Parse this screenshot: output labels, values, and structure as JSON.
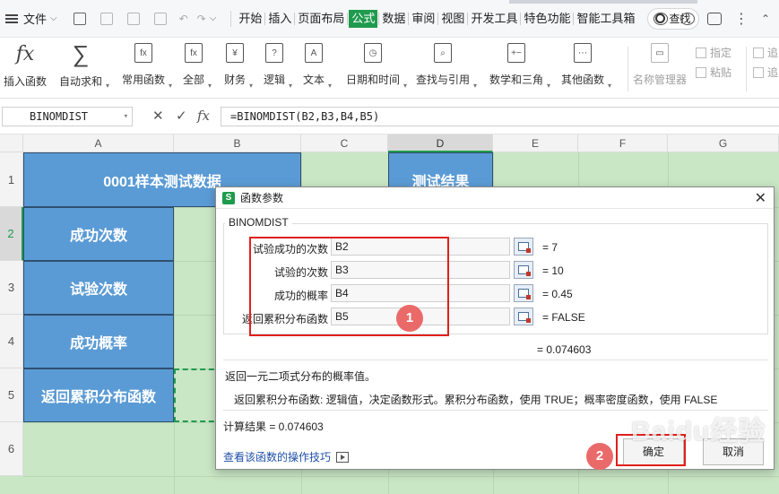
{
  "menubar": {
    "file_label": "文件",
    "tabs": [
      "开始",
      "插入",
      "页面布局",
      "公式",
      "数据",
      "审阅",
      "视图",
      "开发工具",
      "特色功能",
      "智能工具箱"
    ],
    "active_tab": "公式",
    "search_label": "查找"
  },
  "ribbon": {
    "items": [
      {
        "label": "插入函数",
        "icon": "fx-icon"
      },
      {
        "label": "自动求和",
        "icon": "sum-icon"
      },
      {
        "label": "常用函数",
        "icon": "star-function-icon"
      },
      {
        "label": "全部",
        "icon": "all-function-icon"
      },
      {
        "label": "财务",
        "icon": "finance-icon"
      },
      {
        "label": "逻辑",
        "icon": "logic-icon"
      },
      {
        "label": "文本",
        "icon": "text-icon"
      },
      {
        "label": "日期和时间",
        "icon": "clock-icon"
      },
      {
        "label": "查找与引用",
        "icon": "lookup-icon"
      },
      {
        "label": "数学和三角",
        "icon": "math-icon"
      },
      {
        "label": "其他函数",
        "icon": "more-function-icon"
      },
      {
        "label": "名称管理器",
        "icon": "name-manager-icon"
      }
    ],
    "side_items": [
      "指定",
      "粘贴"
    ],
    "far_right_items": [
      "追",
      "追"
    ]
  },
  "formula_bar": {
    "name_box": "BINOMDIST",
    "formula": "=BINOMDIST(B2,B3,B4,B5)"
  },
  "sheet": {
    "columns": [
      "A",
      "B",
      "C",
      "D",
      "E",
      "F",
      "G"
    ],
    "rows": [
      "1",
      "2",
      "3",
      "4",
      "5",
      "6"
    ],
    "a1": "0001样本测试数据",
    "d1": "测试结果",
    "a2": "成功次数",
    "a3": "试验次数",
    "a4": "成功概率",
    "a5": "返回累积分布函数"
  },
  "dialog": {
    "title": "函数参数",
    "function_name": "BINOMDIST",
    "args": [
      {
        "label": "试验成功的次数",
        "input": "B2",
        "value": "= 7"
      },
      {
        "label": "试验的次数",
        "input": "B3",
        "value": "= 10"
      },
      {
        "label": "成功的概率",
        "input": "B4",
        "value": "= 0.45"
      },
      {
        "label": "返回累积分布函数",
        "input": "B5",
        "value": "= FALSE"
      }
    ],
    "result_value": "= 0.074603",
    "description": "返回一元二项式分布的概率值。",
    "arg_description": "返回累积分布函数:  逻辑值，决定函数形式。累积分布函数，使用 TRUE；概率密度函数，使用 FALSE",
    "calc_result": "计算结果  =  0.074603",
    "help_link": "查看该函数的操作技巧",
    "ok_label": "确定",
    "cancel_label": "取消"
  },
  "annotations": {
    "badge_1": "1",
    "badge_2": "2",
    "watermark": "Baidu经验"
  },
  "colors": {
    "accent": "#1f9b4d",
    "header_cell": "#5b9bd5",
    "sheet_bg": "#c9e6c5",
    "annotation_red": "#e0201a"
  }
}
